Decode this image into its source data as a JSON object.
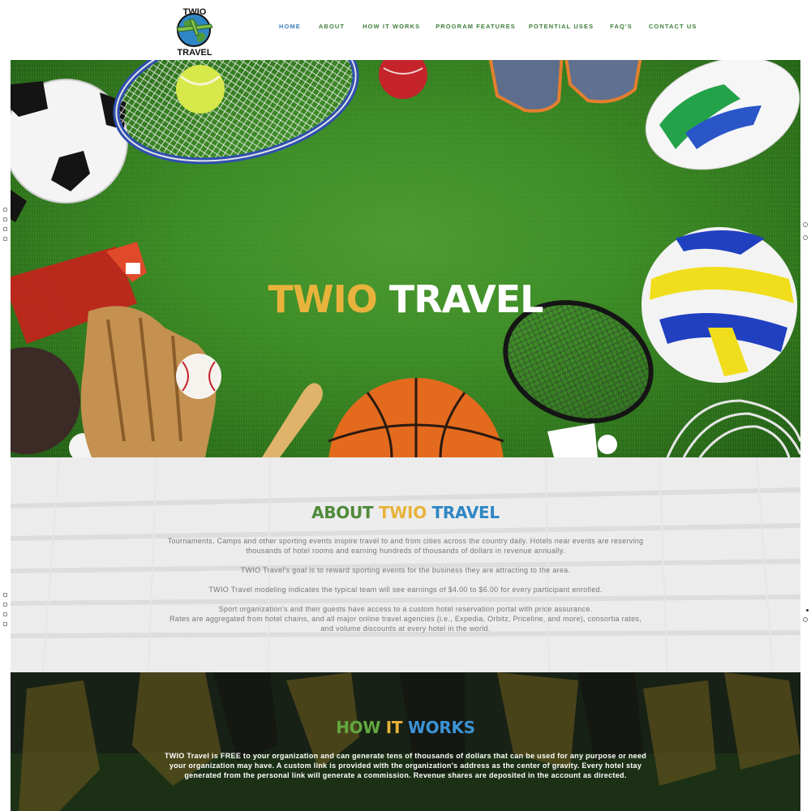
{
  "header": {
    "logo": {
      "top_text": "TWIO",
      "bottom_text": "TRAVEL",
      "icon": "globe-airplane-icon"
    },
    "nav": [
      {
        "label": "HOME",
        "active": true
      },
      {
        "label": "ABOUT",
        "active": false
      },
      {
        "label": "HOW IT WORKS",
        "active": false
      },
      {
        "label": "PROGRAM FEATURES",
        "active": false
      },
      {
        "label": "POTENTIAL USES",
        "active": false
      },
      {
        "label": "FAQ'S",
        "active": false
      },
      {
        "label": "CONTACT US",
        "active": false
      }
    ]
  },
  "hero": {
    "title_part1": "TWIO",
    "title_part2": "TRAVEL"
  },
  "about": {
    "title_part1": "ABOUT",
    "title_part2": "TWIO",
    "title_part3": "TRAVEL",
    "paragraphs": [
      "Tournaments, Camps and other sporting events inspire travel to and from cities across the country daily. Hotels near events are reserving thousands of hotel rooms and earning hundreds of thousands of dollars in revenue annually.",
      "TWIO Travel's goal is to reward sporting events for the business they are attracting to the area.",
      "TWIO Travel modeling indicates the typical team will see earnings of $4.00 to $6.00 for every participant enrolled.",
      "Sport organization's and their guests have access to a custom hotel reservation portal with price assurance.",
      "Rates are aggregated from hotel chains, and all major online travel agencies (i.e., Expedia, Orbitz, Priceline, and more), consortia rates, and volume discounts at every hotel in the world."
    ]
  },
  "how_it_works": {
    "title_part1": "HOW",
    "title_part2": "IT",
    "title_part3": "WORKS",
    "text": "TWIO Travel is FREE to your organization and can generate tens of thousands of dollars that can be used for any purpose or need your organization may have. A custom link is provided with the organization's address as the center of gravity. Every hotel stay generated from the personal link will generate a commission. Revenue shares are deposited in the account as directed."
  },
  "colors": {
    "brand_green": "#4f8a3a",
    "brand_gold": "#e8b33c",
    "brand_blue": "#2f86c4",
    "nav_active": "#3c7fb8"
  }
}
